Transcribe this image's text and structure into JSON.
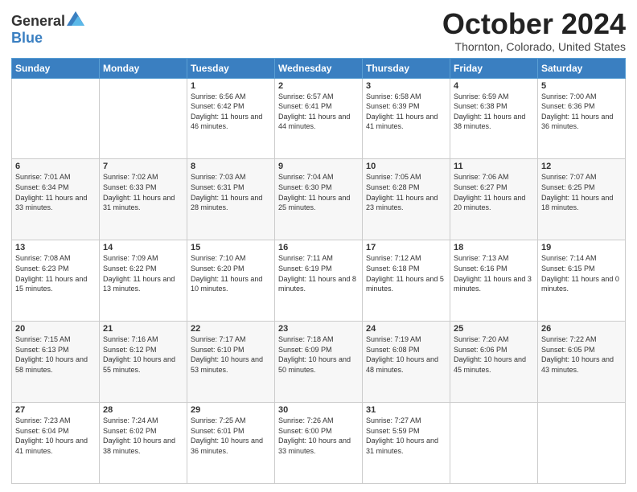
{
  "header": {
    "logo_general": "General",
    "logo_blue": "Blue",
    "month_title": "October 2024",
    "location": "Thornton, Colorado, United States"
  },
  "weekdays": [
    "Sunday",
    "Monday",
    "Tuesday",
    "Wednesday",
    "Thursday",
    "Friday",
    "Saturday"
  ],
  "weeks": [
    [
      {
        "day": "",
        "info": ""
      },
      {
        "day": "",
        "info": ""
      },
      {
        "day": "1",
        "info": "Sunrise: 6:56 AM\nSunset: 6:42 PM\nDaylight: 11 hours and 46 minutes."
      },
      {
        "day": "2",
        "info": "Sunrise: 6:57 AM\nSunset: 6:41 PM\nDaylight: 11 hours and 44 minutes."
      },
      {
        "day": "3",
        "info": "Sunrise: 6:58 AM\nSunset: 6:39 PM\nDaylight: 11 hours and 41 minutes."
      },
      {
        "day": "4",
        "info": "Sunrise: 6:59 AM\nSunset: 6:38 PM\nDaylight: 11 hours and 38 minutes."
      },
      {
        "day": "5",
        "info": "Sunrise: 7:00 AM\nSunset: 6:36 PM\nDaylight: 11 hours and 36 minutes."
      }
    ],
    [
      {
        "day": "6",
        "info": "Sunrise: 7:01 AM\nSunset: 6:34 PM\nDaylight: 11 hours and 33 minutes."
      },
      {
        "day": "7",
        "info": "Sunrise: 7:02 AM\nSunset: 6:33 PM\nDaylight: 11 hours and 31 minutes."
      },
      {
        "day": "8",
        "info": "Sunrise: 7:03 AM\nSunset: 6:31 PM\nDaylight: 11 hours and 28 minutes."
      },
      {
        "day": "9",
        "info": "Sunrise: 7:04 AM\nSunset: 6:30 PM\nDaylight: 11 hours and 25 minutes."
      },
      {
        "day": "10",
        "info": "Sunrise: 7:05 AM\nSunset: 6:28 PM\nDaylight: 11 hours and 23 minutes."
      },
      {
        "day": "11",
        "info": "Sunrise: 7:06 AM\nSunset: 6:27 PM\nDaylight: 11 hours and 20 minutes."
      },
      {
        "day": "12",
        "info": "Sunrise: 7:07 AM\nSunset: 6:25 PM\nDaylight: 11 hours and 18 minutes."
      }
    ],
    [
      {
        "day": "13",
        "info": "Sunrise: 7:08 AM\nSunset: 6:23 PM\nDaylight: 11 hours and 15 minutes."
      },
      {
        "day": "14",
        "info": "Sunrise: 7:09 AM\nSunset: 6:22 PM\nDaylight: 11 hours and 13 minutes."
      },
      {
        "day": "15",
        "info": "Sunrise: 7:10 AM\nSunset: 6:20 PM\nDaylight: 11 hours and 10 minutes."
      },
      {
        "day": "16",
        "info": "Sunrise: 7:11 AM\nSunset: 6:19 PM\nDaylight: 11 hours and 8 minutes."
      },
      {
        "day": "17",
        "info": "Sunrise: 7:12 AM\nSunset: 6:18 PM\nDaylight: 11 hours and 5 minutes."
      },
      {
        "day": "18",
        "info": "Sunrise: 7:13 AM\nSunset: 6:16 PM\nDaylight: 11 hours and 3 minutes."
      },
      {
        "day": "19",
        "info": "Sunrise: 7:14 AM\nSunset: 6:15 PM\nDaylight: 11 hours and 0 minutes."
      }
    ],
    [
      {
        "day": "20",
        "info": "Sunrise: 7:15 AM\nSunset: 6:13 PM\nDaylight: 10 hours and 58 minutes."
      },
      {
        "day": "21",
        "info": "Sunrise: 7:16 AM\nSunset: 6:12 PM\nDaylight: 10 hours and 55 minutes."
      },
      {
        "day": "22",
        "info": "Sunrise: 7:17 AM\nSunset: 6:10 PM\nDaylight: 10 hours and 53 minutes."
      },
      {
        "day": "23",
        "info": "Sunrise: 7:18 AM\nSunset: 6:09 PM\nDaylight: 10 hours and 50 minutes."
      },
      {
        "day": "24",
        "info": "Sunrise: 7:19 AM\nSunset: 6:08 PM\nDaylight: 10 hours and 48 minutes."
      },
      {
        "day": "25",
        "info": "Sunrise: 7:20 AM\nSunset: 6:06 PM\nDaylight: 10 hours and 45 minutes."
      },
      {
        "day": "26",
        "info": "Sunrise: 7:22 AM\nSunset: 6:05 PM\nDaylight: 10 hours and 43 minutes."
      }
    ],
    [
      {
        "day": "27",
        "info": "Sunrise: 7:23 AM\nSunset: 6:04 PM\nDaylight: 10 hours and 41 minutes."
      },
      {
        "day": "28",
        "info": "Sunrise: 7:24 AM\nSunset: 6:02 PM\nDaylight: 10 hours and 38 minutes."
      },
      {
        "day": "29",
        "info": "Sunrise: 7:25 AM\nSunset: 6:01 PM\nDaylight: 10 hours and 36 minutes."
      },
      {
        "day": "30",
        "info": "Sunrise: 7:26 AM\nSunset: 6:00 PM\nDaylight: 10 hours and 33 minutes."
      },
      {
        "day": "31",
        "info": "Sunrise: 7:27 AM\nSunset: 5:59 PM\nDaylight: 10 hours and 31 minutes."
      },
      {
        "day": "",
        "info": ""
      },
      {
        "day": "",
        "info": ""
      }
    ]
  ]
}
